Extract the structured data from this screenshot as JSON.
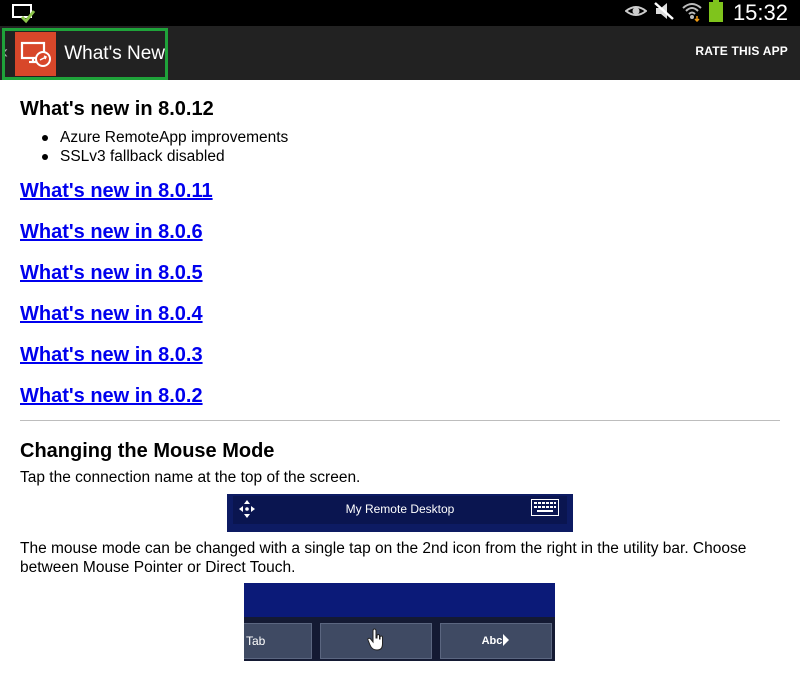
{
  "status_bar": {
    "time": "15:32",
    "icons": [
      "cast-notification-icon",
      "eye-icon",
      "mute-icon",
      "wifi-icon",
      "battery-icon"
    ]
  },
  "action_bar": {
    "title": "What's New",
    "rate_label": "RATE THIS APP",
    "icon": "remote-desktop-icon",
    "highlight_color": "#1fa33a",
    "icon_color": "#d8472a"
  },
  "content": {
    "current_heading": "What's new in 8.0.12",
    "current_items": [
      "Azure RemoteApp improvements",
      "SSLv3 fallback disabled"
    ],
    "version_links": [
      "What's new in 8.0.11",
      "What's new in 8.0.6",
      "What's new in 8.0.5",
      "What's new in 8.0.4",
      "What's new in 8.0.3",
      "What's new in 8.0.2"
    ],
    "mouse_heading": "Changing the Mouse Mode",
    "mouse_p1": "Tap the connection name at the top of the screen.",
    "mouse_p2": "The mouse mode can be changed with a single tap on the 2nd icon from the right in the utility bar. Choose between Mouse Pointer or Direct Touch."
  },
  "image_connection_bar": {
    "label": "My Remote Desktop",
    "icons": [
      "move-arrows-icon",
      "keyboard-icon"
    ]
  },
  "image_utility_bar": {
    "keys": [
      "Tab",
      "",
      "Abc"
    ],
    "icons": [
      "hand-pointer-icon",
      "play-arrow-icon"
    ]
  }
}
